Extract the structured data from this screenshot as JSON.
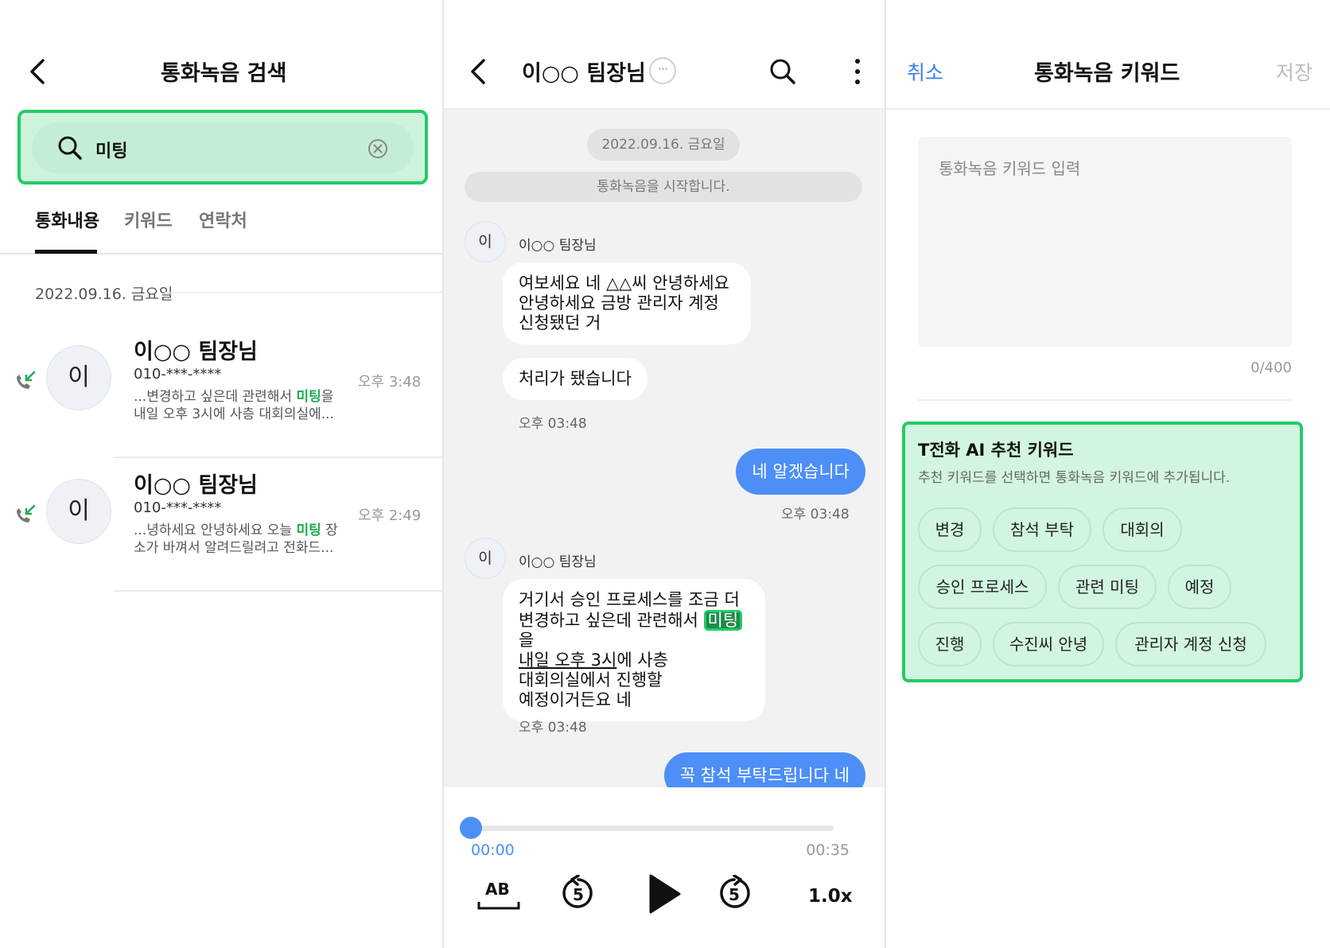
{
  "search_panel": {
    "title": "통화녹음 검색",
    "search": {
      "value": "미팅"
    },
    "tabs": [
      {
        "label": "통화내용",
        "active": true
      },
      {
        "label": "키워드",
        "active": false
      },
      {
        "label": "연락처",
        "active": false
      }
    ],
    "date": "2022.09.16. 금요일",
    "results": [
      {
        "avatar": "이",
        "name": "이○○ 팀장님",
        "number": "010-***-****",
        "time": "오후 3:48",
        "snippet_before": "...변경하고 싶은데 관련해서 ",
        "snippet_match": "미팅",
        "snippet_after": "을 내일 오후 3시에 사층 대회의실에..."
      },
      {
        "avatar": "이",
        "name": "이○○ 팀장님",
        "number": "010-***-****",
        "time": "오후 2:49",
        "snippet_before": "...녕하세요 안녕하세요 오늘 ",
        "snippet_match": "미팅",
        "snippet_after": " 장소가 바껴서 알려드릴려고 전화드..."
      }
    ]
  },
  "chat_panel": {
    "title": "이○○ 팀장님",
    "more_label": "···",
    "date_pill": "2022.09.16. 금요일",
    "system_msg": "통화녹음을 시작합니다.",
    "sender_avatar": "이",
    "sender_name": "이○○ 팀장님",
    "msg1_lines": [
      "여보세요 네 △△씨 안녕하세요",
      "안녕하세요 금방 관리자 계정",
      "신청됐던 거"
    ],
    "msg2": "처리가 됐습니다",
    "msg2_time": "오후 03:48",
    "out1": "네 알겠습니다",
    "out1_time": "오후 03:48",
    "msg3": {
      "line1": "거기서 승인 프로세스를 조금 더",
      "line2_before": "변경하고 싶은데 관련해서 ",
      "line2_match": "미팅",
      "line2_after": "을",
      "line3_underlined": "내일 오후 3시",
      "line3_after": "에 사층",
      "line4": "대회의실에서 진행할",
      "line5": "예정이거든요 네"
    },
    "msg3_time": "오후 03:48",
    "out2": "꼭 참석 부탁드립니다 네",
    "player": {
      "current": "00:00",
      "total": "00:35",
      "progress": 0,
      "ab_label": "AB",
      "skip_seconds": "5",
      "speed": "1.0x"
    },
    "colors": {
      "accent": "#4d8ff7"
    }
  },
  "keyword_panel": {
    "cancel": "취소",
    "title": "통화녹음 키워드",
    "save": "저장",
    "placeholder": "통화녹음 키워드 입력",
    "counter": "0/400",
    "ai_title": "T전화 AI 추천 키워드",
    "ai_sub": "추천 키워드를 선택하면 통화녹음 키워드에 추가됩니다.",
    "chips": [
      "변경",
      "참석 부탁",
      "대회의",
      "승인 프로세스",
      "관련 미팅",
      "예정",
      "진행",
      "수진씨 안녕",
      "관리자 계정 신청"
    ],
    "colors": {
      "highlight": "#22cc66",
      "link": "#3b7ef0"
    }
  }
}
